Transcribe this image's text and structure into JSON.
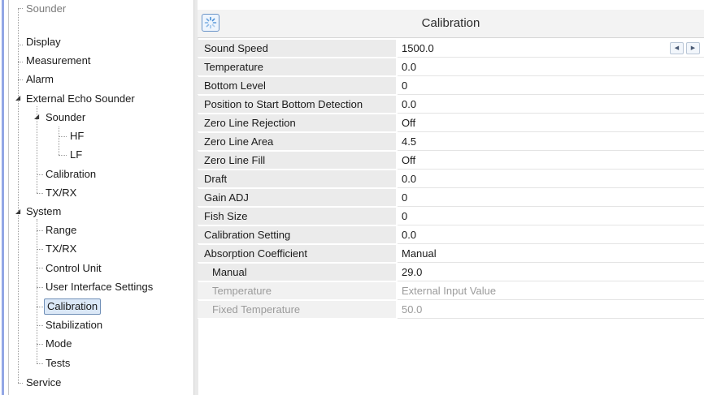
{
  "tree": {
    "items": [
      {
        "label": "Sounder",
        "muted": true
      },
      {
        "label": "Display"
      },
      {
        "label": "Measurement"
      },
      {
        "label": "Alarm"
      },
      {
        "label": "External Echo Sounder"
      },
      {
        "label": "Sounder"
      },
      {
        "label": "HF"
      },
      {
        "label": "LF"
      },
      {
        "label": "Calibration"
      },
      {
        "label": "TX/RX"
      },
      {
        "label": "System"
      },
      {
        "label": "Range"
      },
      {
        "label": "TX/RX"
      },
      {
        "label": "Control Unit"
      },
      {
        "label": "User Interface Settings"
      },
      {
        "label": "Calibration",
        "selected": true
      },
      {
        "label": "Stabilization"
      },
      {
        "label": "Mode"
      },
      {
        "label": "Tests"
      },
      {
        "label": "Service"
      }
    ],
    "icons": {
      "expanded": "triangle-expanded-icon"
    }
  },
  "header": {
    "title": "Calibration",
    "icon": "loading-spinner-icon"
  },
  "properties": [
    {
      "name": "Sound Speed",
      "value": "1500.0",
      "stepper": true
    },
    {
      "name": "Temperature",
      "value": "0.0"
    },
    {
      "name": "Bottom Level",
      "value": "0"
    },
    {
      "name": "Position to Start Bottom Detection",
      "value": "0.0"
    },
    {
      "name": "Zero Line Rejection",
      "value": "Off"
    },
    {
      "name": "Zero Line Area",
      "value": "4.5"
    },
    {
      "name": "Zero Line Fill",
      "value": "Off"
    },
    {
      "name": "Draft",
      "value": "0.0"
    },
    {
      "name": "Gain ADJ",
      "value": "0"
    },
    {
      "name": "Fish Size",
      "value": "0"
    },
    {
      "name": "Calibration Setting",
      "value": "0.0"
    },
    {
      "name": "Absorption Coefficient",
      "value": "Manual"
    },
    {
      "name": "Manual",
      "value": "29.0",
      "indent": true
    },
    {
      "name": "Temperature",
      "value": "External Input Value",
      "indent": true,
      "disabled": true
    },
    {
      "name": "Fixed Temperature",
      "value": "50.0",
      "indent": true,
      "disabled": true
    }
  ],
  "stepper": {
    "left_icon": "chevron-left-icon",
    "right_icon": "chevron-right-icon",
    "left_glyph": "◀",
    "right_glyph": "▶"
  },
  "colors": {
    "selection_border": "#6f8fb7",
    "selection_fill": "#dbe8f7",
    "name_cell": "#ebebeb",
    "disabled_text": "#9b9b9b"
  }
}
